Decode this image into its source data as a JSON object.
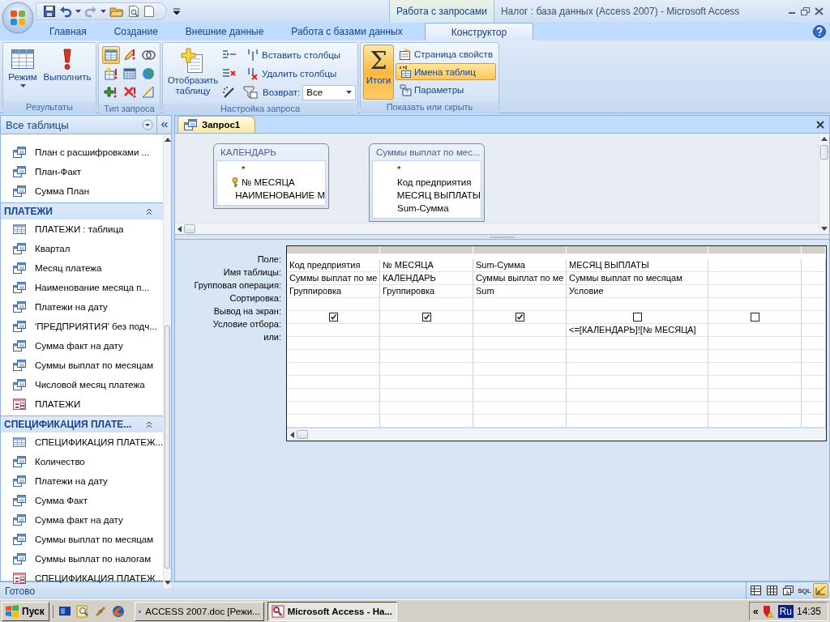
{
  "window": {
    "title": "Налог : база данных (Access 2007) - Microsoft Access",
    "context_group": "Работа с запросами"
  },
  "ribbon_tabs": [
    {
      "label": "Главная",
      "selected": false
    },
    {
      "label": "Создание",
      "selected": false
    },
    {
      "label": "Внешние данные",
      "selected": false
    },
    {
      "label": "Работа с базами данных",
      "selected": false
    },
    {
      "label": "Конструктор",
      "selected": true
    }
  ],
  "ribbon": {
    "results": {
      "label": "Результаты",
      "view": "Режим",
      "run": "Выполнить"
    },
    "query_type": {
      "label": "Тип запроса",
      "options": [
        {
          "selected": true
        },
        {
          "selected": false
        },
        {
          "selected": false
        },
        {
          "selected": false
        },
        {
          "selected": false
        },
        {
          "selected": false
        },
        {
          "selected": false
        },
        {
          "selected": false
        },
        {
          "selected": false
        }
      ]
    },
    "setup": {
      "label": "Настройка запроса",
      "show_table": "Отобразить таблицу",
      "insert_columns": "Вставить столбцы",
      "delete_columns": "Удалить столбцы",
      "return_label": "Возврат:",
      "return_value": "Все"
    },
    "show_hide": {
      "label": "Показать или скрыть",
      "totals": {
        "symbol": "Σ",
        "label": "Итоги",
        "on": true
      },
      "toggles": [
        {
          "label": "Страница свойств",
          "on": false
        },
        {
          "label": "Имена таблиц",
          "on": true
        },
        {
          "label": "Параметры",
          "on": false
        }
      ]
    }
  },
  "nav": {
    "title": "Все таблицы",
    "items": [
      {
        "kind": "query",
        "label": "План с расшифровками ..."
      },
      {
        "kind": "query",
        "label": "План-Факт"
      },
      {
        "kind": "query",
        "label": "Сумма План"
      },
      {
        "kind": "group",
        "label": "ПЛАТЕЖИ",
        "expanded": true
      },
      {
        "kind": "table",
        "label": "ПЛАТЕЖИ : таблица"
      },
      {
        "kind": "query",
        "label": "Квартал"
      },
      {
        "kind": "query",
        "label": "Месяц платежа"
      },
      {
        "kind": "query",
        "label": "Наименование месяца п..."
      },
      {
        "kind": "query",
        "label": "Платежи на дату"
      },
      {
        "kind": "query",
        "label": "'ПРЕДПРИЯТИЯ' без подч..."
      },
      {
        "kind": "query",
        "label": "Сумма факт на дату"
      },
      {
        "kind": "query",
        "label": "Суммы выплат по месяцам"
      },
      {
        "kind": "query",
        "label": "Числовой месяц платежа"
      },
      {
        "kind": "form",
        "label": "ПЛАТЕЖИ"
      },
      {
        "kind": "group",
        "label": "СПЕЦИФИКАЦИЯ ПЛАТЕ...",
        "expanded": true
      },
      {
        "kind": "table",
        "label": "СПЕЦИФИКАЦИЯ ПЛАТЕЖ..."
      },
      {
        "kind": "query",
        "label": "Количество"
      },
      {
        "kind": "query",
        "label": "Платежи на дату"
      },
      {
        "kind": "query",
        "label": "Сумма Факт"
      },
      {
        "kind": "query",
        "label": "Сумма факт на дату"
      },
      {
        "kind": "query",
        "label": "Суммы выплат по месяцам"
      },
      {
        "kind": "query",
        "label": "Суммы выплат по налогам"
      },
      {
        "kind": "form",
        "label": "СПЕЦИФИКАЦИЯ ПЛАТЕЖ..."
      }
    ]
  },
  "document": {
    "tab": "Запрос1",
    "tables": [
      {
        "title": "КАЛЕНДАРЬ",
        "fields": [
          {
            "name": "*",
            "key": false
          },
          {
            "name": "№ МЕСЯЦА",
            "key": true
          },
          {
            "name": "НАИМЕНОВАНИЕ М",
            "key": false
          }
        ]
      },
      {
        "title": "Суммы выплат по мес...",
        "fields": [
          {
            "name": "*",
            "key": false
          },
          {
            "name": "Код предприятия",
            "key": false
          },
          {
            "name": "МЕСЯЦ ВЫПЛАТЫ",
            "key": false
          },
          {
            "name": "Sum-Сумма",
            "key": false
          }
        ]
      }
    ],
    "row_labels": [
      "Поле:",
      "Имя таблицы:",
      "Групповая операция:",
      "Сортировка:",
      "Вывод на экран:",
      "Условие отбора:",
      "или:"
    ],
    "columns": [
      {
        "field": "Код предприятия",
        "table": "Суммы выплат по ме",
        "total": "Группировка",
        "show": true
      },
      {
        "field": "№ МЕСЯЦА",
        "table": "КАЛЕНДАРЬ",
        "total": "Группировка",
        "show": true
      },
      {
        "field": "Sum-Сумма",
        "table": "Суммы выплат по ме",
        "total": "Sum",
        "show": true
      },
      {
        "field": "МЕСЯЦ ВЫПЛАТЫ",
        "table": "Суммы выплат по месяцам",
        "total": "Условие",
        "show": false,
        "criteria": "<=[КАЛЕНДАРЬ]![№ МЕСЯЦА]"
      },
      {
        "show": false
      }
    ]
  },
  "status_bar": {
    "text": "Готово",
    "views": [
      {
        "kind": "datasheet",
        "selected": false
      },
      {
        "kind": "pivot_table",
        "selected": false
      },
      {
        "kind": "pivot_chart",
        "selected": false
      },
      {
        "kind": "sql",
        "label": "SQL",
        "selected": false
      },
      {
        "kind": "design",
        "selected": true
      }
    ]
  },
  "taskbar": {
    "start": "Пуск",
    "tasks": [
      {
        "kind": "word",
        "label": "ACCESS 2007.doc [Режи...",
        "selected": false
      },
      {
        "kind": "access",
        "label": "Microsoft Access - На...",
        "selected": true
      }
    ],
    "tray": {
      "expand": "«",
      "language": "Ru",
      "time": "14:35"
    }
  }
}
